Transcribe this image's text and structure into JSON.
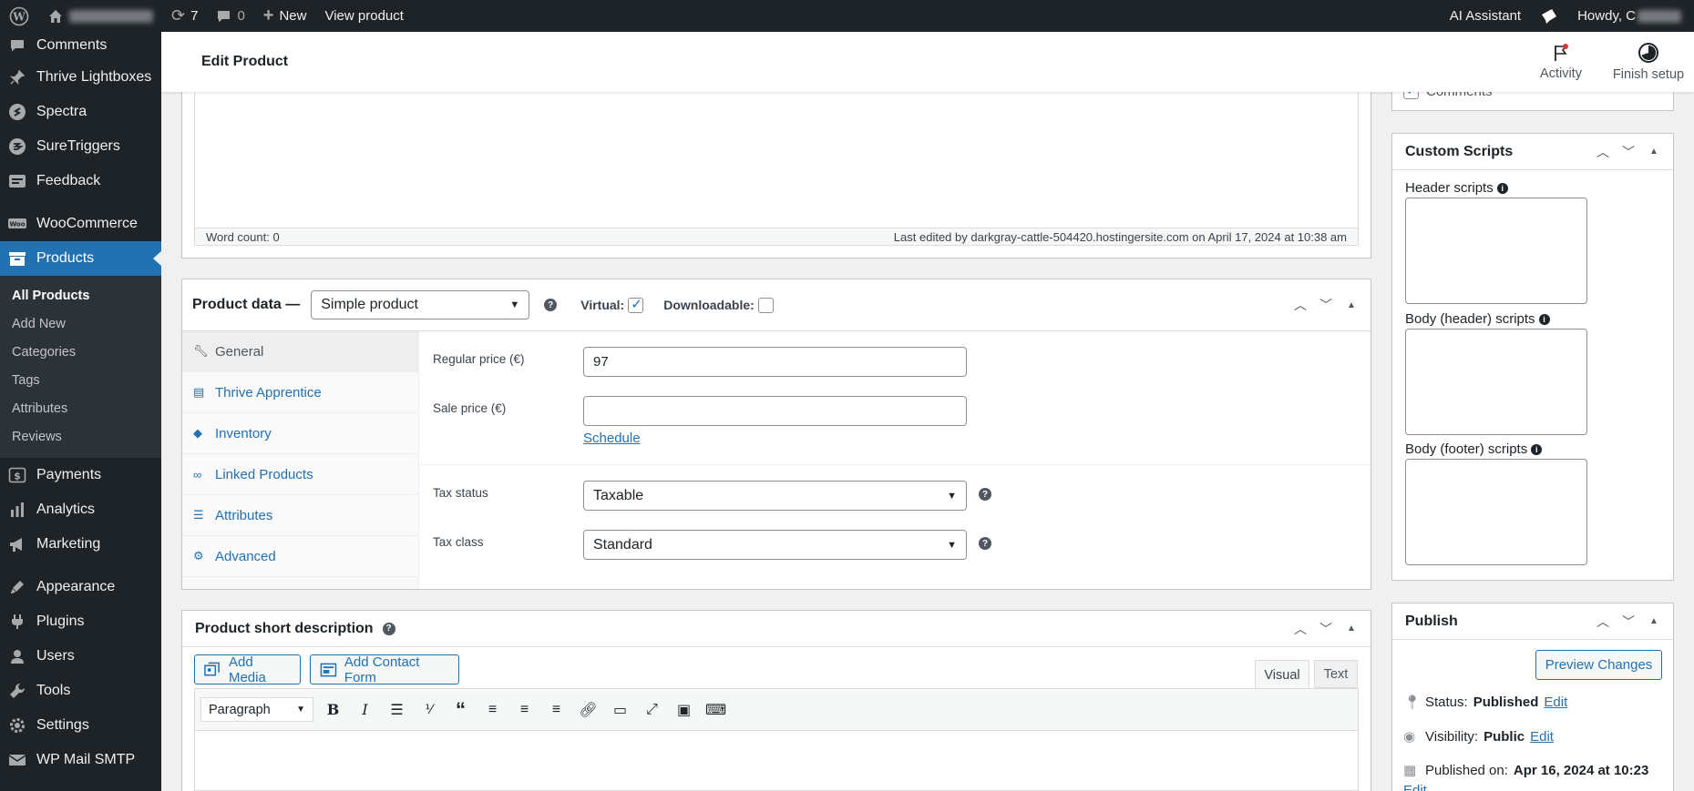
{
  "adminbar": {
    "updates_count": "7",
    "comments_count": "0",
    "new_label": "New",
    "view_product_label": "View product",
    "ai_assistant_label": "AI Assistant",
    "howdy_label": "Howdy, C"
  },
  "sidebar": {
    "items_top": [
      {
        "label": "Comments",
        "icon": "comment-icon"
      },
      {
        "label": "Thrive Lightboxes",
        "icon": "pin-icon"
      },
      {
        "label": "Spectra",
        "icon": "spectra-icon"
      },
      {
        "label": "SureTriggers",
        "icon": "suretriggers-icon"
      },
      {
        "label": "Feedback",
        "icon": "feedback-icon"
      }
    ],
    "woocommerce": "WooCommerce",
    "products": "Products",
    "submenu": [
      "All Products",
      "Add New",
      "Categories",
      "Tags",
      "Attributes",
      "Reviews"
    ],
    "items_mid": [
      {
        "label": "Payments",
        "icon": "payments-icon"
      },
      {
        "label": "Analytics",
        "icon": "analytics-icon"
      },
      {
        "label": "Marketing",
        "icon": "marketing-icon"
      }
    ],
    "items_bottom": [
      {
        "label": "Appearance",
        "icon": "appearance-icon"
      },
      {
        "label": "Plugins",
        "icon": "plugins-icon"
      },
      {
        "label": "Users",
        "icon": "users-icon"
      },
      {
        "label": "Tools",
        "icon": "tools-icon"
      },
      {
        "label": "Settings",
        "icon": "settings-icon"
      },
      {
        "label": "WP Mail SMTP",
        "icon": "mail-icon"
      }
    ]
  },
  "header": {
    "title": "Edit Product",
    "activity_label": "Activity",
    "finish_setup_label": "Finish setup"
  },
  "editor": {
    "word_count": "Word count: 0",
    "last_edited": "Last edited by darkgray-cattle-504420.hostingersite.com on April 17, 2024 at 10:38 am"
  },
  "product_data": {
    "title": "Product data —",
    "type_value": "Simple product",
    "virtual_label": "Virtual:",
    "virtual_checked": true,
    "downloadable_label": "Downloadable:",
    "downloadable_checked": false,
    "tabs": [
      {
        "label": "General",
        "icon": "wrench-icon"
      },
      {
        "label": "Thrive Apprentice",
        "icon": "book-icon"
      },
      {
        "label": "Inventory",
        "icon": "tag-icon"
      },
      {
        "label": "Linked Products",
        "icon": "link-icon"
      },
      {
        "label": "Attributes",
        "icon": "list-icon"
      },
      {
        "label": "Advanced",
        "icon": "gear-icon"
      }
    ],
    "regular_price_label": "Regular price (€)",
    "regular_price_value": "97",
    "sale_price_label": "Sale price (€)",
    "sale_price_value": "",
    "schedule_label": "Schedule",
    "tax_status_label": "Tax status",
    "tax_status_value": "Taxable",
    "tax_class_label": "Tax class",
    "tax_class_value": "Standard"
  },
  "short_description": {
    "title": "Product short description",
    "add_media_label": "Add Media",
    "add_contact_form_label": "Add Contact Form",
    "visual_tab": "Visual",
    "text_tab": "Text",
    "paragraph_value": "Paragraph"
  },
  "right": {
    "comments_label": "Comments",
    "custom_scripts_title": "Custom Scripts",
    "header_scripts_label": "Header scripts",
    "body_header_scripts_label": "Body (header) scripts",
    "body_footer_scripts_label": "Body (footer) scripts",
    "publish_title": "Publish",
    "preview_changes_label": "Preview Changes",
    "status_label": "Status:",
    "status_value": "Published",
    "visibility_label": "Visibility:",
    "visibility_value": "Public",
    "published_on_label": "Published on:",
    "published_on_value": "Apr 16, 2024 at 10:23",
    "edit_label": "Edit"
  }
}
